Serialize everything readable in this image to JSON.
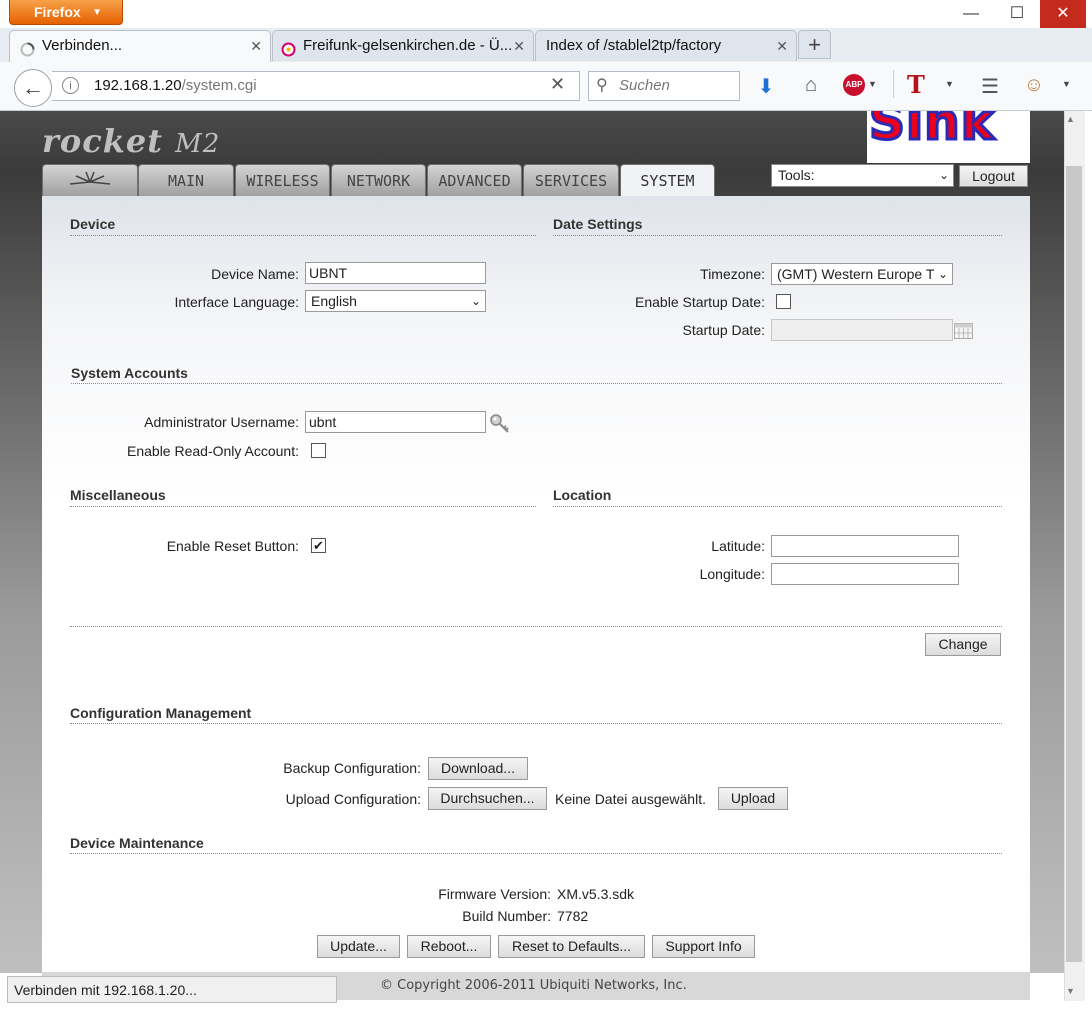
{
  "browser": {
    "app_button": "Firefox",
    "window_controls": {
      "minimize": "—",
      "maximize": "☐",
      "close": "✕"
    },
    "tabs": [
      {
        "label": "Verbinden...",
        "icon": "loading-spinner-icon"
      },
      {
        "label": "Freifunk-gelsenkirchen.de - Ü...",
        "icon": "freifunk-favicon-icon"
      },
      {
        "label": "Index of /stablel2tp/factory",
        "icon": ""
      }
    ],
    "url": {
      "host": "192.168.1.20",
      "path": "/system.cgi"
    },
    "search_placeholder": "Suchen",
    "status_text": "Verbinden mit 192.168.1.20..."
  },
  "header": {
    "logo_text": "rocket",
    "logo_model": "M2",
    "banner_text": "Sink"
  },
  "nav": {
    "tabs": [
      "MAIN",
      "WIRELESS",
      "NETWORK",
      "ADVANCED",
      "SERVICES",
      "SYSTEM"
    ],
    "active": "SYSTEM",
    "tools_label": "Tools:",
    "logout_label": "Logout"
  },
  "device": {
    "title": "Device",
    "device_name_label": "Device Name:",
    "device_name_value": "UBNT",
    "language_label": "Interface Language:",
    "language_value": "English"
  },
  "date_settings": {
    "title": "Date Settings",
    "timezone_label": "Timezone:",
    "timezone_value": "(GMT) Western Europe T",
    "startup_label": "Enable Startup Date:",
    "startup_checked": false,
    "startup_date_label": "Startup Date:",
    "startup_date_value": ""
  },
  "accounts": {
    "title": "System Accounts",
    "admin_label": "Administrator Username:",
    "admin_value": "ubnt",
    "readonly_label": "Enable Read-Only Account:",
    "readonly_checked": false
  },
  "misc": {
    "title": "Miscellaneous",
    "reset_label": "Enable Reset Button:",
    "reset_checked": true
  },
  "location": {
    "title": "Location",
    "latitude_label": "Latitude:",
    "latitude_value": "",
    "longitude_label": "Longitude:",
    "longitude_value": ""
  },
  "change_label": "Change",
  "config": {
    "title": "Configuration Management",
    "backup_label": "Backup Configuration:",
    "download_btn": "Download...",
    "upload_label": "Upload Configuration:",
    "browse_btn": "Durchsuchen...",
    "no_file_text": "Keine Datei ausgewählt.",
    "upload_btn": "Upload"
  },
  "maintenance": {
    "title": "Device Maintenance",
    "firmware_label": "Firmware Version:",
    "firmware_value": "XM.v5.3.sdk",
    "build_label": "Build Number:",
    "build_value": "7782",
    "update_btn": "Update...",
    "reboot_btn": "Reboot...",
    "reset_btn": "Reset to Defaults...",
    "support_btn": "Support Info"
  },
  "footer": {
    "copyright": "© Copyright 2006-2011 Ubiquiti Networks, Inc."
  },
  "colors": {
    "firefox_orange": "#e66000",
    "close_red": "#c42b1c",
    "banner_red": "#e8001c",
    "banner_blue": "#2a2ab8"
  }
}
